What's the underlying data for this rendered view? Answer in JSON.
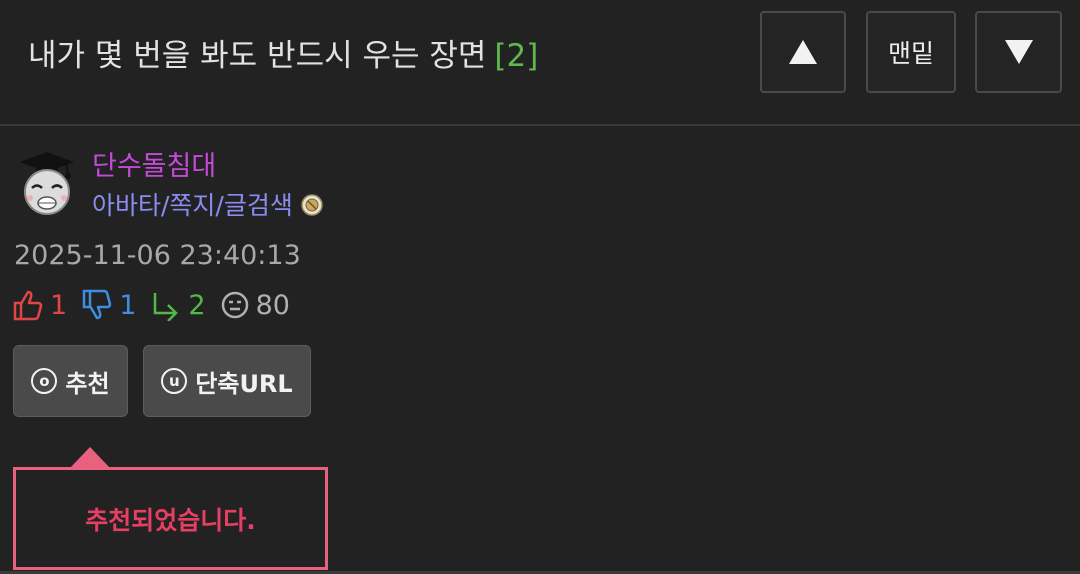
{
  "header": {
    "title": "내가 몇 번을 봐도 반드시 우는 장면",
    "comment_count": "[2]",
    "nav": {
      "up_icon": "triangle-up-icon",
      "bottom_label": "맨밑",
      "down_icon": "triangle-down-icon"
    }
  },
  "author": {
    "name": "단수돌침대",
    "links": "아바타/쪽지/글검색",
    "avatar_icon": "avatar-graduation-cap"
  },
  "post": {
    "timestamp": "2025-11-06 23:40:13",
    "stats": {
      "upvotes": "1",
      "downvotes": "1",
      "replies": "2",
      "views": "80"
    }
  },
  "actions": {
    "recommend_icon_glyph": "o",
    "recommend_label": "추천",
    "shorturl_icon_glyph": "u",
    "shorturl_label": "단축URL"
  },
  "popup": {
    "message": "추천되었습니다."
  },
  "colors": {
    "background": "#222222",
    "author_name": "#c44ad8",
    "author_links": "#8a8cf0",
    "upvote": "#e04646",
    "downvote": "#3d8ee0",
    "reply": "#52b848",
    "comment_count": "#5fb84c",
    "popup_border": "#e8627f",
    "popup_text": "#e83e64"
  }
}
